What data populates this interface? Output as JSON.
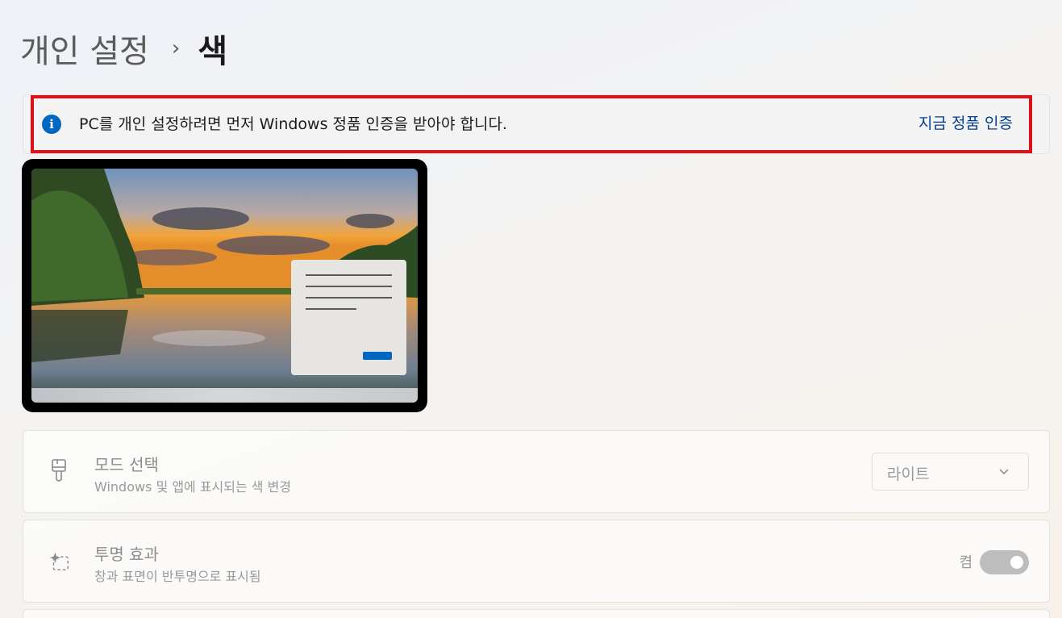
{
  "breadcrumb": {
    "parent": "개인 설정",
    "separator": "›",
    "current": "색"
  },
  "activation_banner": {
    "icon": "info-icon",
    "message": "PC를 개인 설정하려면 먼저 Windows 정품 인증을 받아야 합니다.",
    "link": "지금 정품 인증"
  },
  "settings": {
    "mode": {
      "icon": "paintbrush-icon",
      "title": "모드 선택",
      "subtitle": "Windows 및 앱에 표시되는 색 변경",
      "selected_value": "라이트"
    },
    "transparency": {
      "icon": "sparkle-icon",
      "title": "투명 효과",
      "subtitle": "창과 표면이 반투명으로 표시됨",
      "state_label": "켬",
      "enabled": true
    }
  },
  "colors": {
    "accent": "#0067c0",
    "highlight_border": "#d9121b"
  }
}
